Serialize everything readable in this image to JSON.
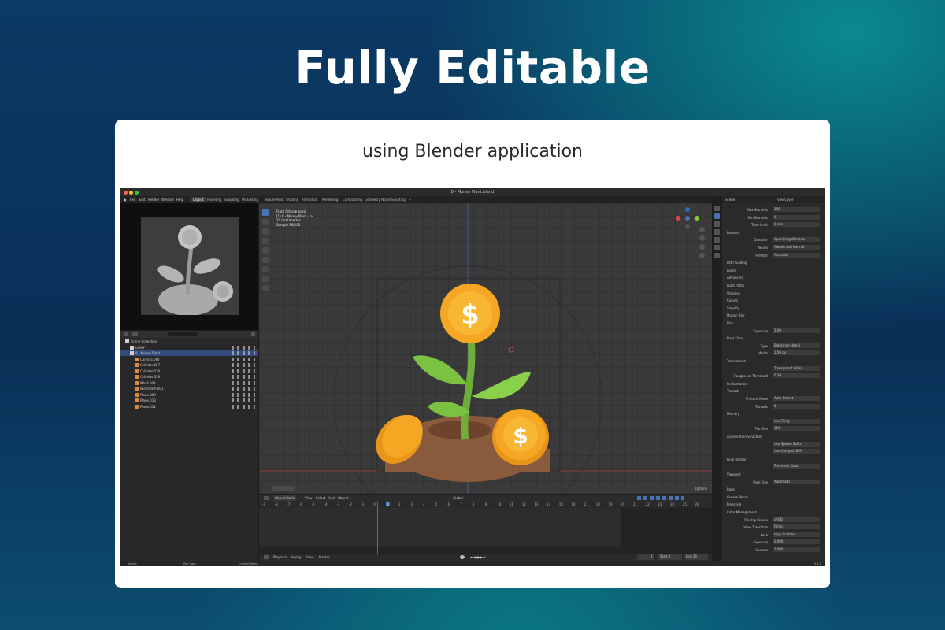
{
  "headline": "Fully Editable",
  "subtitle": "using Blender application",
  "blender": {
    "window_title": "8 - Money Plant.blend",
    "menu": [
      "File",
      "Edit",
      "Render",
      "Window",
      "Help"
    ],
    "workspaces": [
      "Layout",
      "Modeling",
      "Sculpting",
      "UV Editing",
      "Texture Paint",
      "Shading",
      "Animation",
      "Rendering",
      "Compositing",
      "Geometry Nodes",
      "Scripting",
      "+"
    ],
    "viewport_info": [
      "Front Orthographic",
      "(1) 8 - Money Plant =>",
      "10 Centimeters",
      "Sample 96/100"
    ],
    "outliner": {
      "rows": [
        {
          "label": "Scene Collection",
          "indent": 0
        },
        {
          "label": "LIGHT",
          "indent": 1
        },
        {
          "label": "8 - Money Plant",
          "indent": 1,
          "selected": true
        },
        {
          "label": "Camera.066",
          "indent": 2
        },
        {
          "label": "Cylinder.027",
          "indent": 2
        },
        {
          "label": "Cylinder.028",
          "indent": 2
        },
        {
          "label": "Cylinder.029",
          "indent": 2
        },
        {
          "label": "Mball.009",
          "indent": 2
        },
        {
          "label": "NurbsPath.001",
          "indent": 2
        },
        {
          "label": "Plane.009",
          "indent": 2
        },
        {
          "label": "Plane.013",
          "indent": 2
        },
        {
          "label": "Plane.011",
          "indent": 2
        }
      ]
    },
    "timeline": {
      "mode": "Object Mode",
      "menus": [
        "View",
        "Select",
        "Add",
        "Object"
      ],
      "playback": [
        "Playback",
        "Keying",
        "View",
        "Marker"
      ],
      "frames": [
        "-9",
        "-8",
        "-7",
        "-6",
        "-5",
        "-4",
        "-3",
        "-2",
        "-1",
        "0",
        "1",
        "2",
        "3",
        "4",
        "5",
        "6",
        "7",
        "8",
        "9",
        "10",
        "11",
        "12",
        "13",
        "14",
        "15",
        "16",
        "17",
        "18",
        "19",
        "20",
        "21",
        "22",
        "23",
        "24",
        "25",
        "26"
      ],
      "current_frame": "1",
      "start_label": "Start",
      "start": "1",
      "end_label": "End",
      "end": "26",
      "transform": "Global",
      "options": "Options"
    },
    "properties": {
      "scene": "Scene",
      "view_layer": "ViewLayer",
      "rows": [
        {
          "type": "kv",
          "k": "Max Samples",
          "v": "100"
        },
        {
          "type": "kv",
          "k": "Min Samples",
          "v": "0"
        },
        {
          "type": "kv",
          "k": "Time Limit",
          "v": "0 sec"
        },
        {
          "type": "sec",
          "k": "Denoise"
        },
        {
          "type": "kv",
          "k": "Denoiser",
          "v": "OpenImageDenoise"
        },
        {
          "type": "kv",
          "k": "Passes",
          "v": "Albedo and Normal"
        },
        {
          "type": "kv",
          "k": "Prefilter",
          "v": "Accurate"
        },
        {
          "type": "sec",
          "k": "Path Guiding"
        },
        {
          "type": "sec",
          "k": "Lights"
        },
        {
          "type": "sec",
          "k": "Advanced"
        },
        {
          "type": "sec",
          "k": "Light Paths"
        },
        {
          "type": "sec",
          "k": "Volumes"
        },
        {
          "type": "sec",
          "k": "Curves"
        },
        {
          "type": "sec",
          "k": "Simplify"
        },
        {
          "type": "sec",
          "k": "Motion Blur"
        },
        {
          "type": "sec",
          "k": "Film"
        },
        {
          "type": "kv",
          "k": "Exposure",
          "v": "1.00"
        },
        {
          "type": "sec",
          "k": "Pixel Filter"
        },
        {
          "type": "kv",
          "k": "Type",
          "v": "Blackman-Harris"
        },
        {
          "type": "kv",
          "k": "Width",
          "v": "1.50 px"
        },
        {
          "type": "sec",
          "k": "Transparent"
        },
        {
          "type": "kv",
          "k": "",
          "v": "Transparent Glass"
        },
        {
          "type": "kv",
          "k": "Roughness Threshold",
          "v": "0.10"
        },
        {
          "type": "sec",
          "k": "Performance"
        },
        {
          "type": "sec",
          "k": "Threads"
        },
        {
          "type": "kv",
          "k": "Threads Mode",
          "v": "Auto-Detect"
        },
        {
          "type": "kv",
          "k": "Threads",
          "v": "8"
        },
        {
          "type": "sec",
          "k": "Memory"
        },
        {
          "type": "kv",
          "k": "",
          "v": "Use Tiling"
        },
        {
          "type": "kv",
          "k": "Tile Size",
          "v": "256"
        },
        {
          "type": "sec",
          "k": "Acceleration Structure"
        },
        {
          "type": "kv",
          "k": "",
          "v": "Use Spatial Splits"
        },
        {
          "type": "kv",
          "k": "",
          "v": "Use Compact BVH"
        },
        {
          "type": "sec",
          "k": "Final Render"
        },
        {
          "type": "kv",
          "k": "",
          "v": "Persistent Data"
        },
        {
          "type": "sec",
          "k": "Viewport"
        },
        {
          "type": "kv",
          "k": "Pixel Size",
          "v": "Automatic"
        },
        {
          "type": "sec",
          "k": "Bake"
        },
        {
          "type": "sec",
          "k": "Grease Pencil"
        },
        {
          "type": "sec",
          "k": "Freestyle"
        },
        {
          "type": "sec",
          "k": "Color Management"
        },
        {
          "type": "kv",
          "k": "Display Device",
          "v": "sRGB"
        },
        {
          "type": "kv",
          "k": "View Transform",
          "v": "Filmic"
        },
        {
          "type": "kv",
          "k": "Look",
          "v": "High Contrast"
        },
        {
          "type": "kv",
          "k": "Exposure",
          "v": "0.000"
        },
        {
          "type": "kv",
          "k": "Gamma",
          "v": "1.000"
        }
      ]
    },
    "status": [
      "Select",
      "Pan View",
      "Context Menu"
    ],
    "version": "3.4.1",
    "colors": {
      "accent": "#4772b3",
      "coin": "#f5a623",
      "leaf": "#7cc242",
      "soil": "#8a5a3c"
    }
  }
}
